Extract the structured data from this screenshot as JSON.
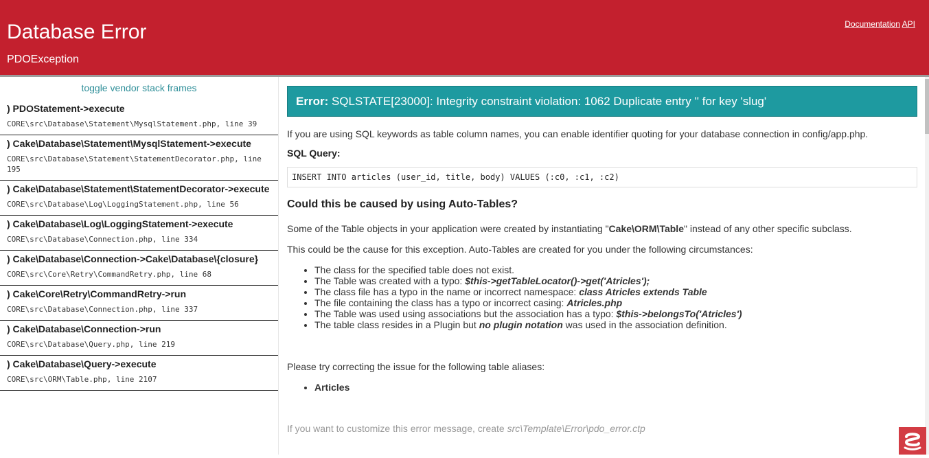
{
  "header": {
    "title": "Database Error",
    "subtitle": "PDOException",
    "links": {
      "documentation": "Documentation",
      "api": "API"
    }
  },
  "stack": {
    "toggle_label": "toggle vendor stack frames",
    "frames": [
      {
        "fn": ") PDOStatement->execute",
        "file": "CORE\\src\\Database\\Statement\\MysqlStatement.php, line 39"
      },
      {
        "fn": ") Cake\\Database\\Statement\\MysqlStatement->execute",
        "file": "CORE\\src\\Database\\Statement\\StatementDecorator.php, line 195"
      },
      {
        "fn": ") Cake\\Database\\Statement\\StatementDecorator->execute",
        "file": "CORE\\src\\Database\\Log\\LoggingStatement.php, line 56"
      },
      {
        "fn": ") Cake\\Database\\Log\\LoggingStatement->execute",
        "file": "CORE\\src\\Database\\Connection.php, line 334"
      },
      {
        "fn": ") Cake\\Database\\Connection->Cake\\Database\\{closure}",
        "file": "CORE\\src\\Core\\Retry\\CommandRetry.php, line 68"
      },
      {
        "fn": ") Cake\\Core\\Retry\\CommandRetry->run",
        "file": "CORE\\src\\Database\\Connection.php, line 337"
      },
      {
        "fn": ") Cake\\Database\\Connection->run",
        "file": "CORE\\src\\Database\\Query.php, line 219"
      },
      {
        "fn": ") Cake\\Database\\Query->execute",
        "file": "CORE\\src\\ORM\\Table.php, line 2107"
      }
    ]
  },
  "main": {
    "error_label": "Error:",
    "error_message": "SQLSTATE[23000]: Integrity constraint violation: 1062 Duplicate entry '' for key 'slug'",
    "keywords_hint": "If you are using SQL keywords as table column names, you can enable identifier quoting for your database connection in config/app.php.",
    "sql_label": "SQL Query:",
    "sql_query": "INSERT INTO articles (user_id, title, body) VALUES (:c0, :c1, :c2)",
    "autotables_heading": "Could this be caused by using Auto-Tables?",
    "autotables_p1_before": "Some of the Table objects in your application were created by instantiating \"",
    "autotables_p1_class": "Cake\\ORM\\Table",
    "autotables_p1_after": "\" instead of any other specific subclass.",
    "autotables_p2": "This could be the cause for this exception. Auto-Tables are created for you under the following circumstances:",
    "circumstances": [
      {
        "text": "The class for the specified table does not exist.",
        "em": "",
        "tail": ""
      },
      {
        "text": "The Table was created with a typo: ",
        "em": "$this->getTableLocator()->get('Atricles');",
        "tail": ""
      },
      {
        "text": "The class file has a typo in the name or incorrect namespace: ",
        "em": "class Atricles extends Table",
        "tail": ""
      },
      {
        "text": "The file containing the class has a typo or incorrect casing: ",
        "em": "Atricles.php",
        "tail": ""
      },
      {
        "text": "The Table was used using associations but the association has a typo: ",
        "em": "$this->belongsTo('Atricles')",
        "tail": ""
      },
      {
        "text": "The table class resides in a Plugin but ",
        "em": "no plugin notation",
        "tail": " was used in the association definition."
      }
    ],
    "aliases_intro": "Please try correcting the issue for the following table aliases:",
    "aliases": [
      "Articles"
    ],
    "customize_before": "If you want to customize this error message, create ",
    "customize_path": "src\\Template\\Error\\pdo_error.ctp"
  },
  "colors": {
    "header_bg": "#c3202e",
    "error_box_bg": "#1e9aa0",
    "link_teal": "#2f8f99",
    "logo_bg": "#d33c44"
  }
}
